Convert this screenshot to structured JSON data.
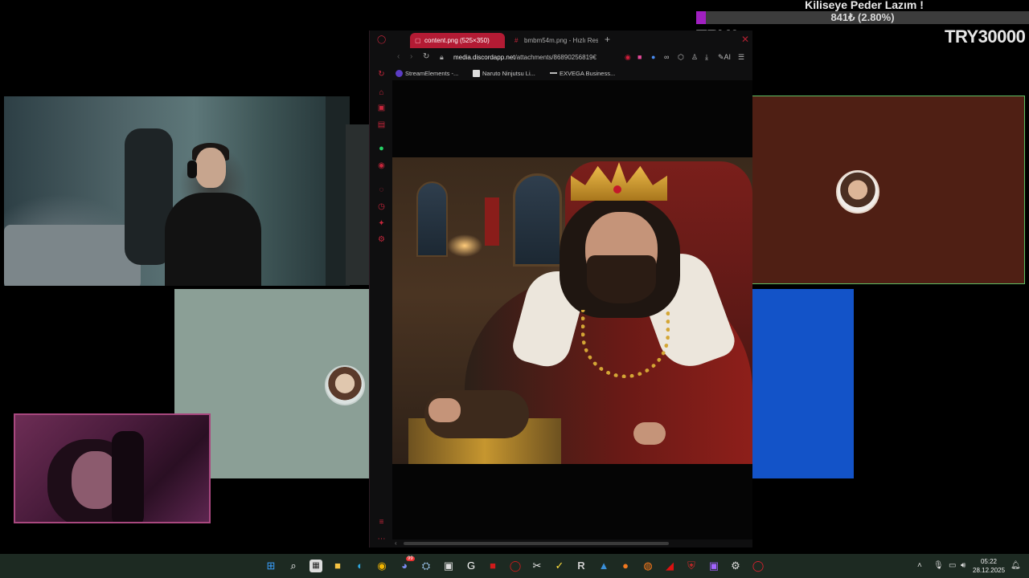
{
  "overlay": {
    "goal_title": "Kiliseye Peder Lazım !",
    "goal_amount": "841₺ (2.80%)",
    "goal_progress": 0.028,
    "current_label": "TRY0",
    "target_label": "TRY30000"
  },
  "browser": {
    "tabs": [
      {
        "label": "content.png (525×350)",
        "icon": "image-icon",
        "active": true
      },
      {
        "label": "bmbm54m.png - Hızlı Res",
        "icon": "hash-icon",
        "active": false
      }
    ],
    "new_tab": "+",
    "url_domain": "media.discordapp.net",
    "url_path": "/attachments/86890256819€",
    "ai_label": "AI",
    "bookmarks": [
      {
        "label": "StreamElements -..."
      },
      {
        "label": "Naruto Ninjutsu Li..."
      },
      {
        "label": "EXVEGA Business..."
      }
    ]
  },
  "taskbar": {
    "discord_badge": "99",
    "clock_time": "05:22",
    "clock_date": "28.12.2025"
  }
}
